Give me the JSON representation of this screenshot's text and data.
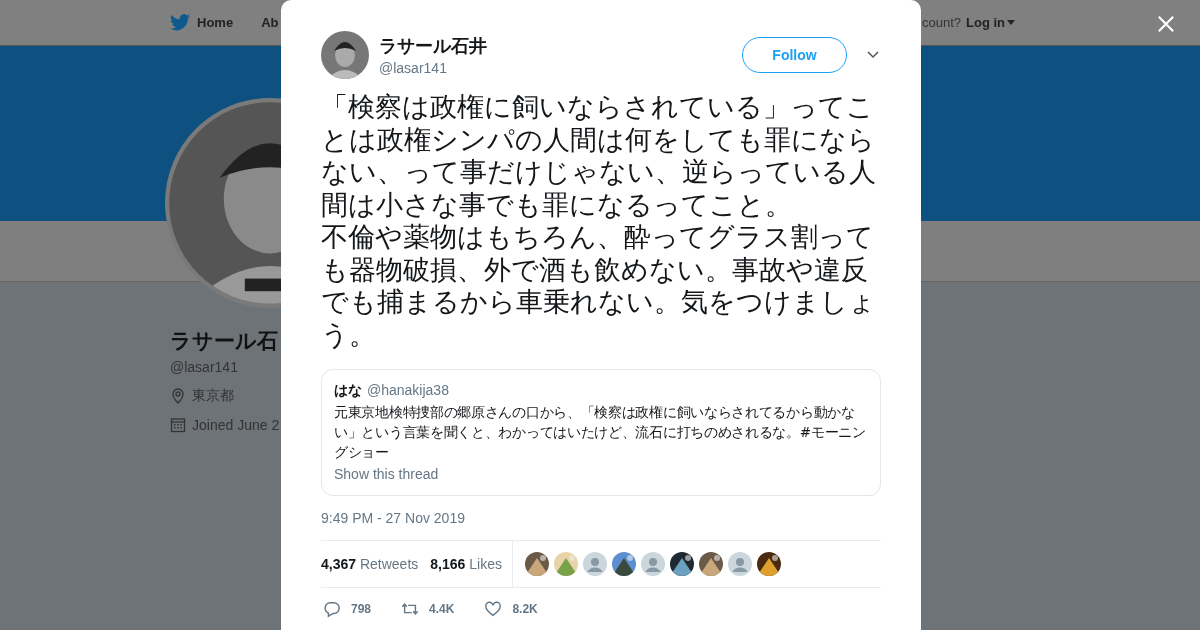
{
  "nav": {
    "home": "Home",
    "about": "Ab",
    "account_prompt": "count?",
    "login": "Log in"
  },
  "profile": {
    "name": "ラサール石",
    "handle": "@lasar141",
    "location": "東京都",
    "joined": "Joined June 2"
  },
  "tweet": {
    "name": "ラサール石井",
    "handle": "@lasar141",
    "follow": "Follow",
    "text": [
      "「検察は政権に飼いならされている」ってことは政権シンパの人間は何をしても罪にならない、って事だけじゃない、逆らっている人間は小さな事でも罪になるってこと。",
      "不倫や薬物はもちろん、酔ってグラス割っても器物破損、外で酒も飲めない。事故や違反でも捕まるから車乗れない。気をつけましょう。"
    ],
    "quote": {
      "name": "はな",
      "handle": "@hanakija38",
      "text": "元東京地検特捜部の郷原さんの口から、「検察は政権に飼いならされてるから動かない」という言葉を聞くと、わかってはいたけど、流石に打ちのめされるな。#モーニングショー",
      "link": "Show this thread"
    },
    "time": "9:49 PM - 27 Nov 2019",
    "stats": [
      {
        "count": "4,367",
        "label": "Retweets"
      },
      {
        "count": "8,166",
        "label": "Likes"
      }
    ],
    "likers": [
      {
        "kind": "picture"
      },
      {
        "kind": "picture"
      },
      {
        "kind": "default"
      },
      {
        "kind": "picture"
      },
      {
        "kind": "default"
      },
      {
        "kind": "picture"
      },
      {
        "kind": "picture"
      },
      {
        "kind": "default"
      },
      {
        "kind": "picture"
      }
    ],
    "actions": [
      {
        "kind": "reply",
        "count": "798"
      },
      {
        "kind": "retweet",
        "count": "4.4K"
      },
      {
        "kind": "like",
        "count": "8.2K"
      }
    ]
  }
}
